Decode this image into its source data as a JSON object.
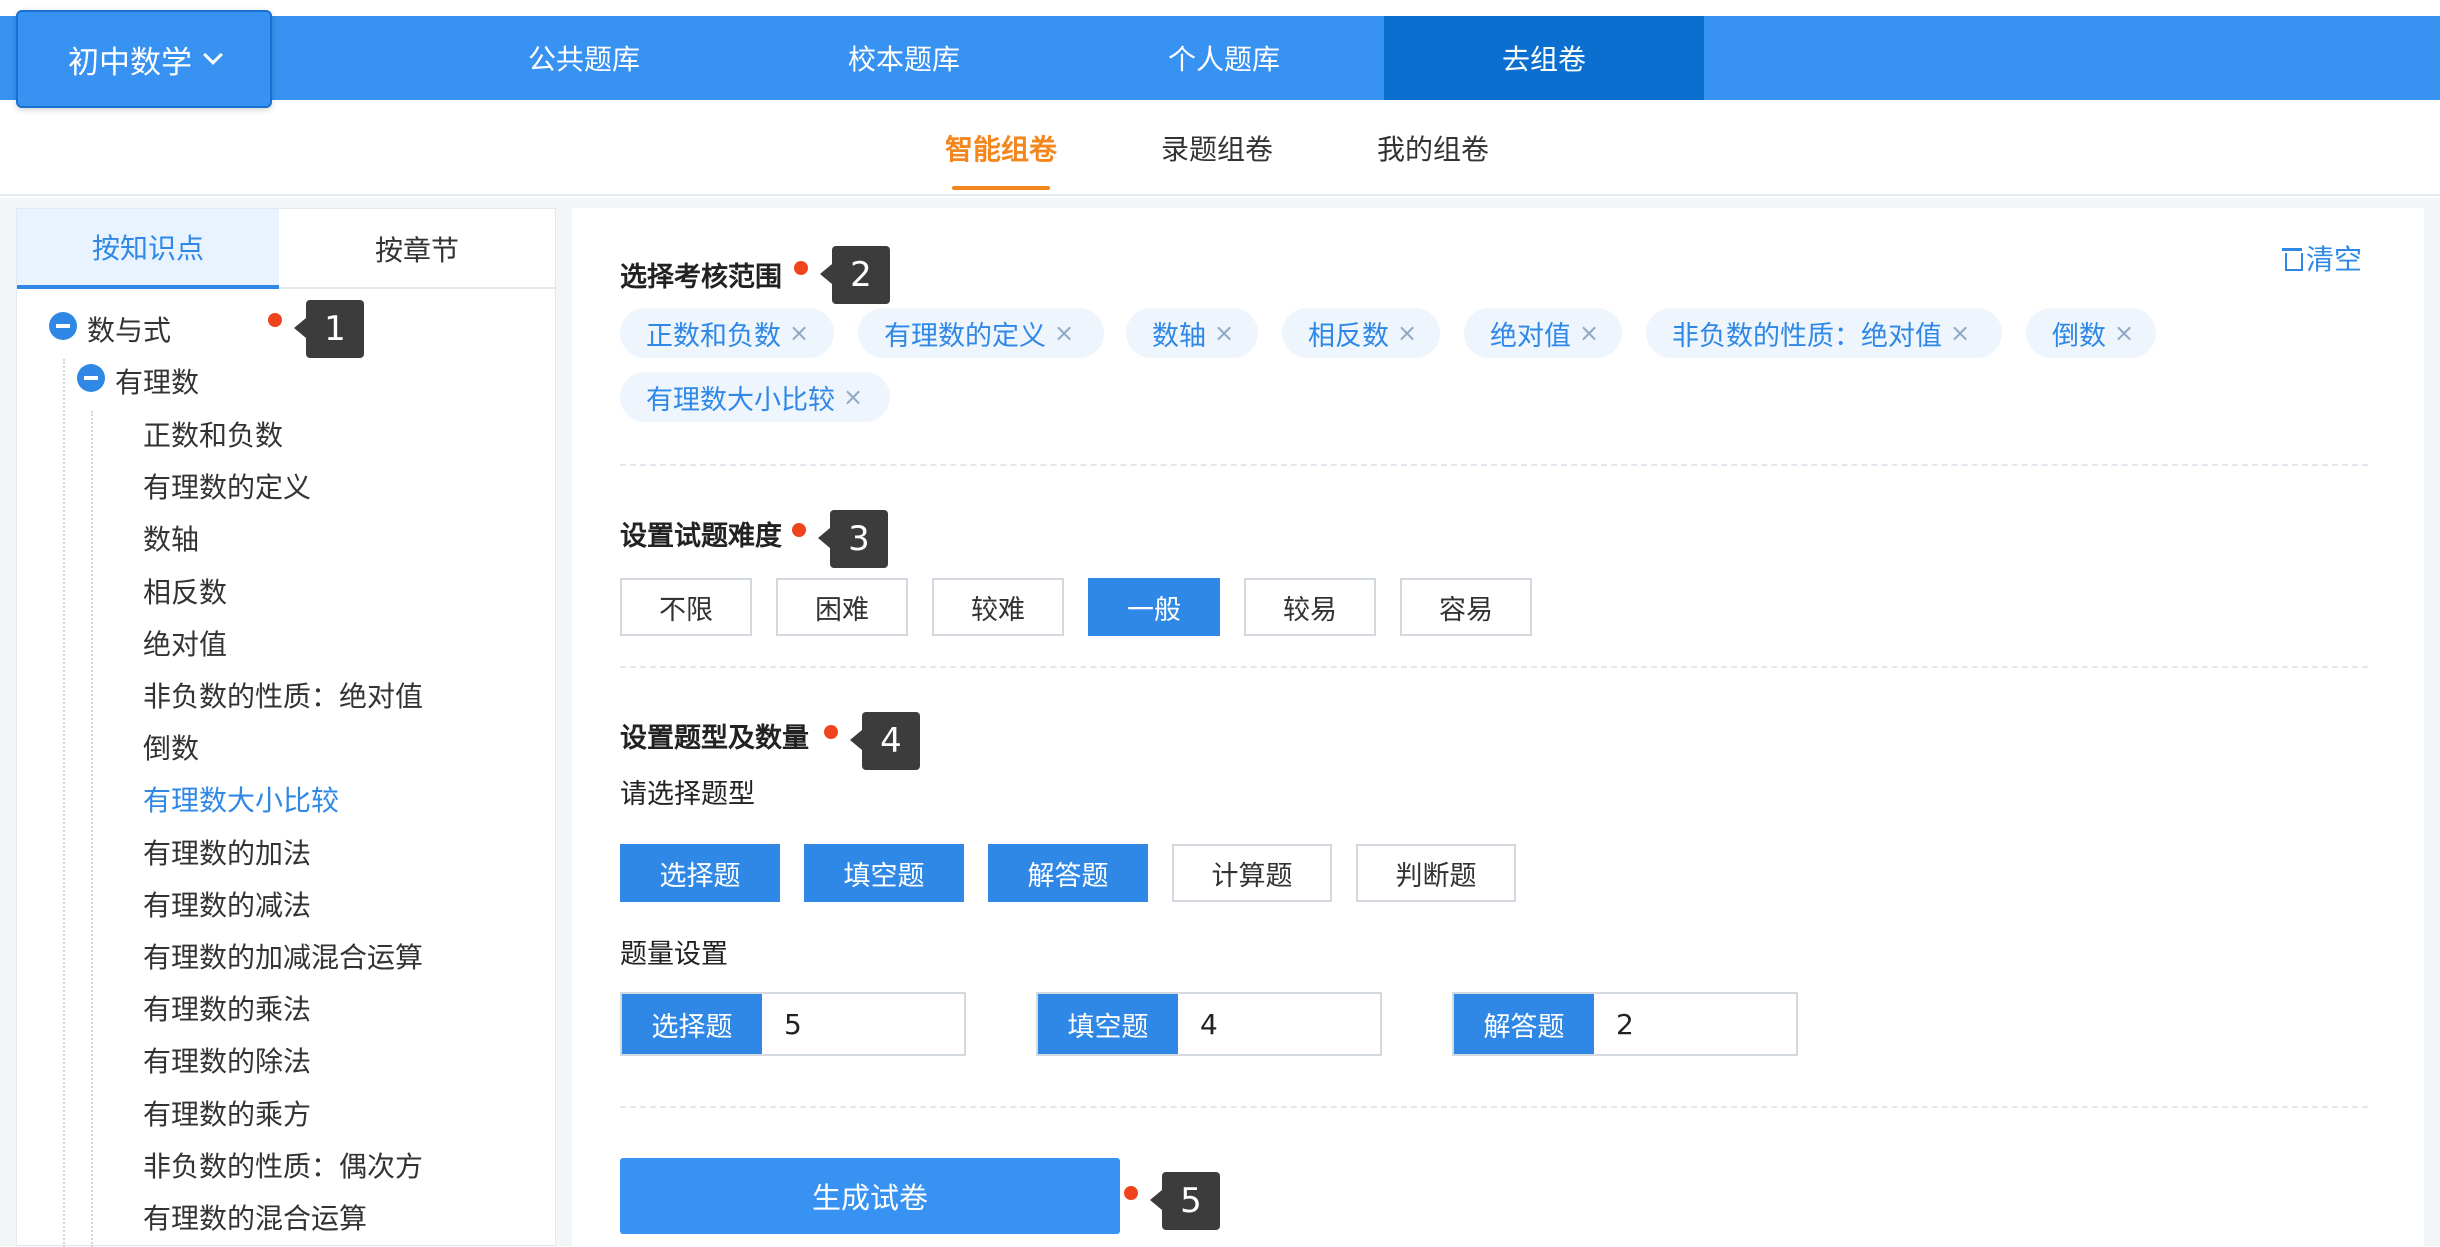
{
  "header": {
    "subject": "初中数学",
    "tabs": [
      {
        "label": "公共题库"
      },
      {
        "label": "校本题库"
      },
      {
        "label": "个人题库"
      },
      {
        "label": "去组卷",
        "active": true
      }
    ]
  },
  "subnav": {
    "tabs": [
      {
        "label": "智能组卷",
        "active": true
      },
      {
        "label": "录题组卷"
      },
      {
        "label": "我的组卷"
      }
    ]
  },
  "left": {
    "tabs": [
      {
        "label": "按知识点",
        "active": true
      },
      {
        "label": "按章节"
      }
    ],
    "tree": {
      "root": "数与式",
      "child": "有理数",
      "leaves": [
        "正数和负数",
        "有理数的定义",
        "数轴",
        "相反数",
        "绝对值",
        "非负数的性质：绝对值",
        "倒数",
        "有理数大小比较",
        "有理数的加法",
        "有理数的减法",
        "有理数的加减混合运算",
        "有理数的乘法",
        "有理数的除法",
        "有理数的乘方",
        "非负数的性质：偶次方",
        "有理数的混合运算"
      ],
      "selected": "有理数大小比较"
    }
  },
  "main": {
    "clear_label": "清空",
    "scope": {
      "title": "选择考核范围",
      "chips": [
        "正数和负数",
        "有理数的定义",
        "数轴",
        "相反数",
        "绝对值",
        "非负数的性质：绝对值",
        "倒数",
        "有理数大小比较"
      ],
      "remove_symbol": "×"
    },
    "difficulty": {
      "title": "设置试题难度",
      "options": [
        "不限",
        "困难",
        "较难",
        "一般",
        "较易",
        "容易"
      ],
      "selected": "一般"
    },
    "types": {
      "title": "设置题型及数量",
      "prompt": "请选择题型",
      "options": [
        "选择题",
        "填空题",
        "解答题",
        "计算题",
        "判断题"
      ],
      "selected": [
        "选择题",
        "填空题",
        "解答题"
      ],
      "qty_title": "题量设置",
      "quantities": [
        {
          "label": "选择题",
          "value": "5"
        },
        {
          "label": "填空题",
          "value": "4"
        },
        {
          "label": "解答题",
          "value": "2"
        }
      ]
    },
    "generate_label": "生成试卷"
  },
  "callouts": [
    "1",
    "2",
    "3",
    "4",
    "5"
  ],
  "colors": {
    "primary": "#3792f1",
    "active_nav": "#0b6fd0",
    "accent_orange": "#f4861e",
    "dot_red": "#f0441d"
  }
}
